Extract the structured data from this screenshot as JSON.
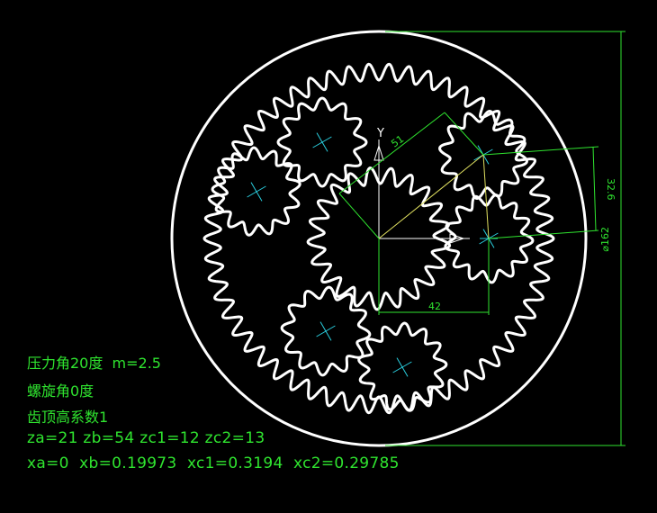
{
  "colors": {
    "background": "#000000",
    "gear": "#ffffff",
    "center_mark": "#2ad0e0",
    "dimension": "#2fe42f",
    "center_line": "#e0e060"
  },
  "gears": {
    "ring": {
      "teeth": 54,
      "label": "zb"
    },
    "sun": {
      "teeth": 21,
      "label": "za"
    },
    "planet_c1": {
      "teeth": 12,
      "label": "zc1"
    },
    "planet_c2": {
      "teeth": 13,
      "label": "zc2"
    }
  },
  "axis": {
    "y_label": "Y"
  },
  "dimensions": {
    "center_distance": "51",
    "offset_vertical": "32.6",
    "horizontal": "42",
    "diameter": "⌀162"
  },
  "notes": {
    "line1": "压力角20度  m=2.5",
    "line2": "螺旋角0度",
    "line3": "齿顶高系数1",
    "line4": "za=21 zb=54 zc1=12 zc2=13",
    "line5": "xa=0  xb=0.19973  xc1=0.3194  xc2=0.29785"
  }
}
